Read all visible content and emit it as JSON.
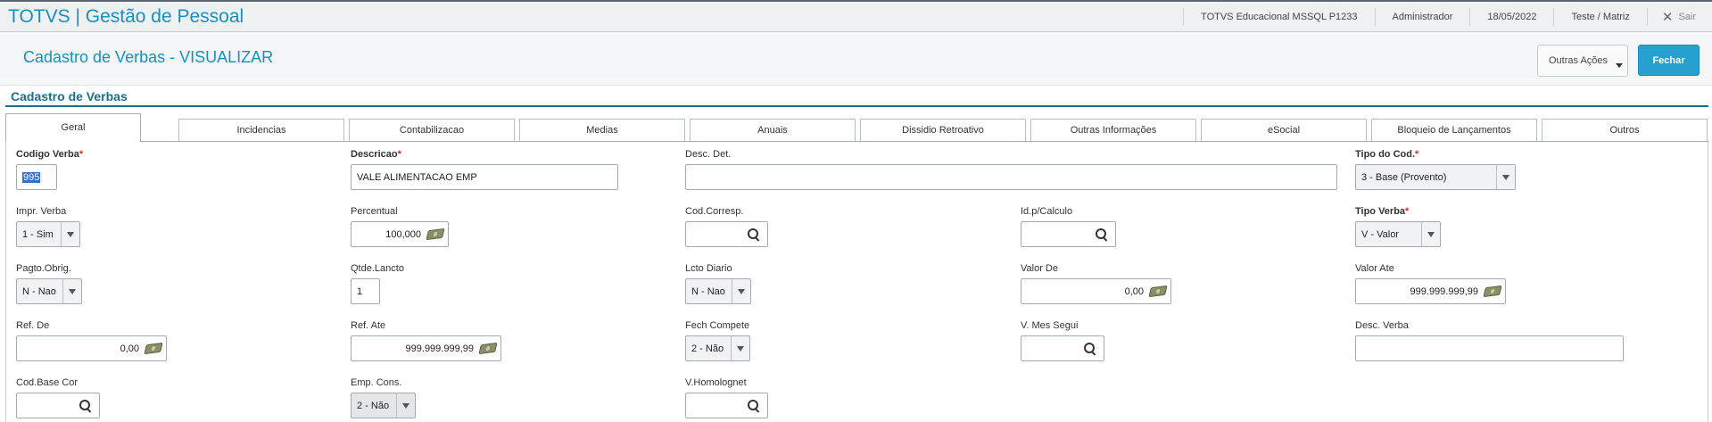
{
  "app": {
    "title": "TOTVS | Gestão de Pessoal",
    "environment": "TOTVS Educacional MSSQL P1233",
    "user": "Administrador",
    "date": "18/05/2022",
    "branch": "Teste / Matriz",
    "logout_label": "Sair"
  },
  "header": {
    "page_title": "Cadastro de Verbas - VISUALIZAR",
    "other_actions_label": "Outras Ações",
    "close_label": "Fechar"
  },
  "section": {
    "title": "Cadastro de Verbas"
  },
  "tabs": [
    "Geral",
    "Incidencias",
    "Contabilizacao",
    "Medias",
    "Anuais",
    "Dissidio Retroativo",
    "Outras Informações",
    "eSocial",
    "Bloqueio de Lançamentos",
    "Outros"
  ],
  "active_tab": "Geral",
  "form": {
    "codigo_verba": {
      "label": "Codigo Verba",
      "value": "995"
    },
    "descricao": {
      "label": "Descricao",
      "value": "VALE ALIMENTACAO EMP"
    },
    "desc_det": {
      "label": "Desc. Det.",
      "value": ""
    },
    "tipo_cod": {
      "label": "Tipo do Cod.",
      "value": "3 - Base (Provento)"
    },
    "impr_verba": {
      "label": "Impr. Verba",
      "value": "1 - Sim"
    },
    "percentual": {
      "label": "Percentual",
      "value": "100,000"
    },
    "cod_corresp": {
      "label": "Cod.Corresp.",
      "value": ""
    },
    "id_calculo": {
      "label": "Id.p/Calculo",
      "value": ""
    },
    "tipo_verba": {
      "label": "Tipo Verba",
      "value": "V - Valor"
    },
    "pagto_obrig": {
      "label": "Pagto.Obrig.",
      "value": "N - Nao"
    },
    "qtde_lancto": {
      "label": "Qtde.Lancto",
      "value": "1"
    },
    "lcto_diario": {
      "label": "Lcto Diario",
      "value": "N - Nao"
    },
    "valor_de": {
      "label": "Valor De",
      "value": "0,00"
    },
    "valor_ate": {
      "label": "Valor Ate",
      "value": "999.999.999,99"
    },
    "ref_de": {
      "label": "Ref. De",
      "value": "0,00"
    },
    "ref_ate": {
      "label": "Ref. Ate",
      "value": "999.999.999,99"
    },
    "fech_compete": {
      "label": "Fech Compete",
      "value": "2 - Não"
    },
    "v_mes_segui": {
      "label": "V. Mes Segui",
      "value": ""
    },
    "desc_verba": {
      "label": "Desc. Verba",
      "value": ""
    },
    "cod_base_cor": {
      "label": "Cod.Base Cor",
      "value": ""
    },
    "emp_cons": {
      "label": "Emp. Cons.",
      "value": "2 - Não"
    },
    "v_homolognet": {
      "label": "V.Homolognet",
      "value": ""
    }
  },
  "colors": {
    "brand": "#1a8fb8",
    "primary_button": "#27a0cf",
    "required_star": "#d62828",
    "section_title": "#1a6e8e"
  }
}
